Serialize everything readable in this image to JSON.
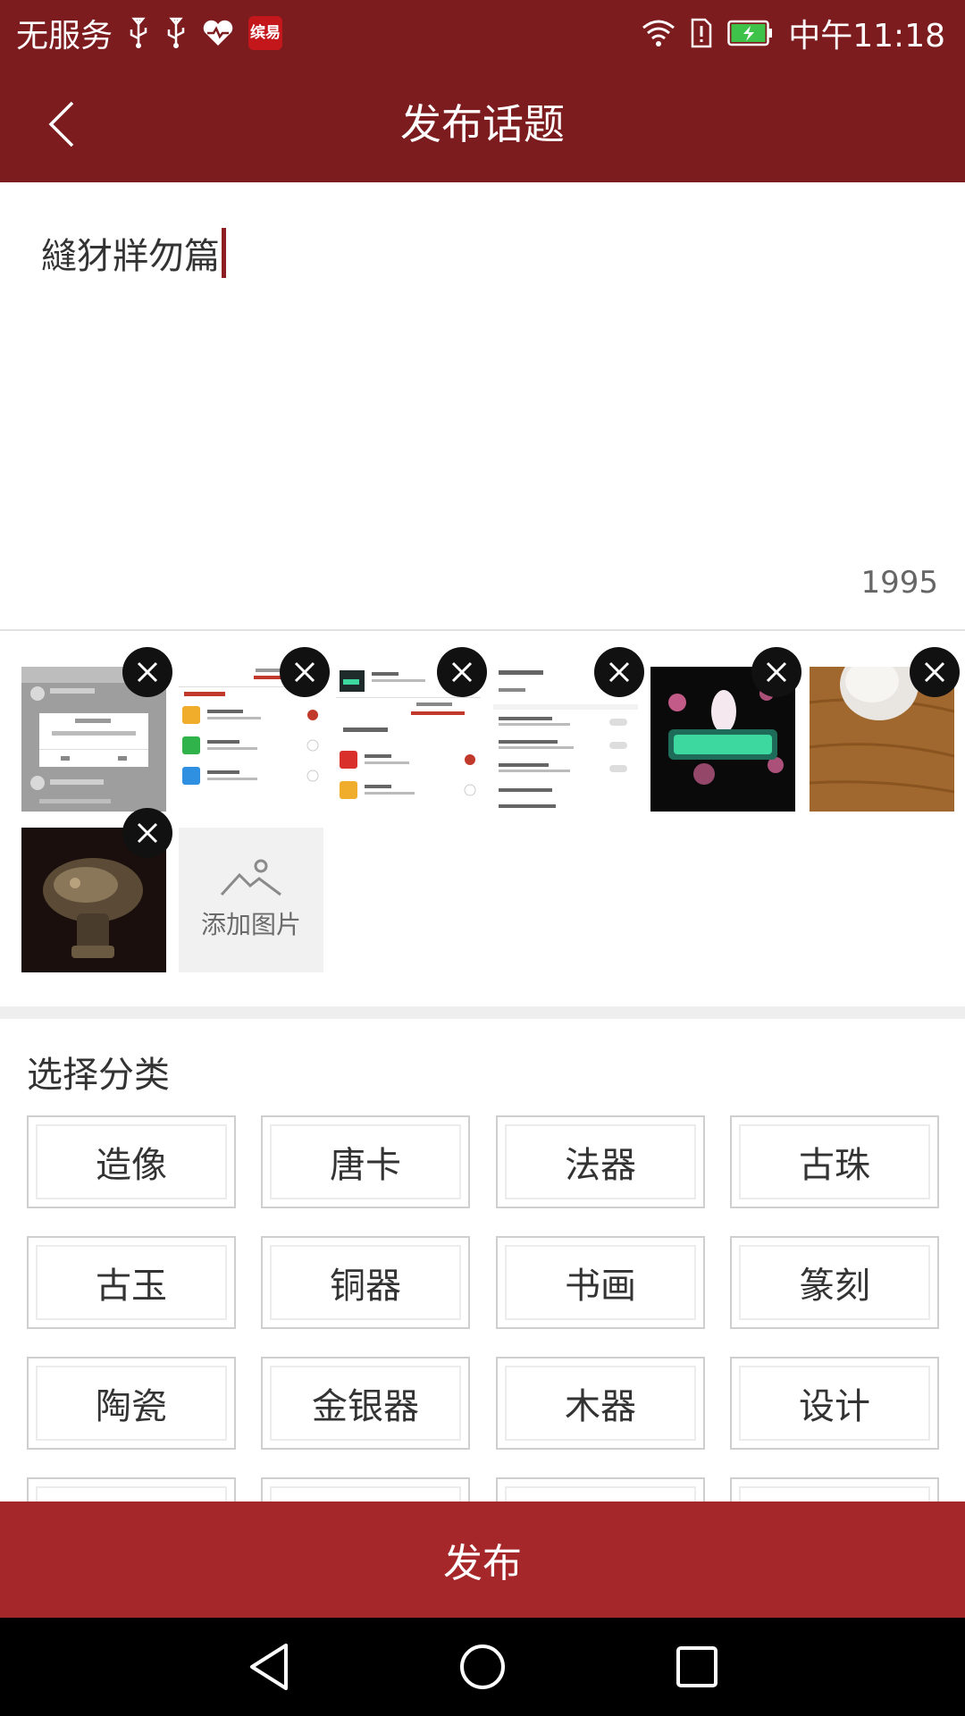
{
  "status_bar": {
    "carrier": "无服务",
    "app_badge": "缤易",
    "time": "中午11:18",
    "icons": [
      "usb-icon",
      "usb-icon",
      "health-icon",
      "app-badge",
      "wifi-icon",
      "sim-alert-icon",
      "battery-charging-icon"
    ]
  },
  "header": {
    "title": "发布话题",
    "back_icon": "chevron-left-icon"
  },
  "editor": {
    "text": "縫犲牂勿篇",
    "char_count": "1995"
  },
  "images": {
    "add_label": "添加图片",
    "add_icon": "mountain-image-icon",
    "remove_icon": "close-icon",
    "count": 7
  },
  "category": {
    "title": "选择分类",
    "items": [
      "造像",
      "唐卡",
      "法器",
      "古珠",
      "古玉",
      "铜器",
      "书画",
      "篆刻",
      "陶瓷",
      "金银器",
      "木器",
      "设计"
    ]
  },
  "publish_label": "发布",
  "nav": [
    "back-triangle-icon",
    "home-circle-icon",
    "recents-square-icon"
  ],
  "colors": {
    "brand": "#7c1c1e",
    "publish": "#a5272a",
    "caret": "#8d1f23"
  }
}
